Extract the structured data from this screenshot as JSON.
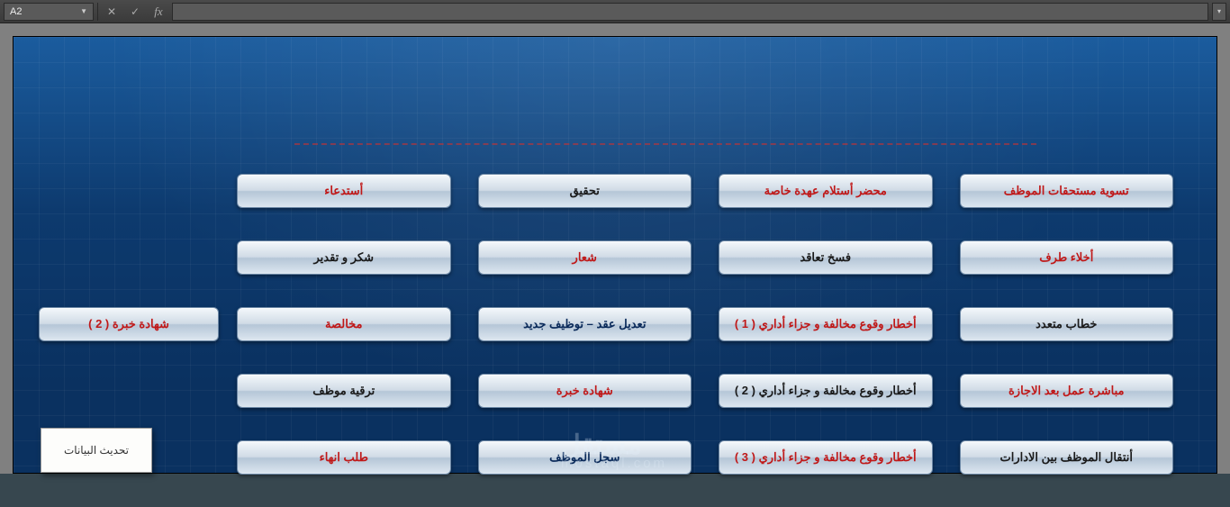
{
  "formula_bar": {
    "cell_ref": "A2",
    "formula": ""
  },
  "buttons": {
    "rows": [
      [
        {
          "label": "تسوية مستحقات الموظف",
          "style": "red"
        },
        {
          "label": "محضر أستلام عهدة خاصة",
          "style": "red"
        },
        {
          "label": "تحقيق",
          "style": "black"
        },
        {
          "label": "أستدعاء",
          "style": "red"
        }
      ],
      [
        {
          "label": "أخلاء طرف",
          "style": "red"
        },
        {
          "label": "فسخ تعاقد",
          "style": "black"
        },
        {
          "label": "شعار",
          "style": "red"
        },
        {
          "label": "شكر و تقدير",
          "style": "black"
        }
      ],
      [
        {
          "label": "خطاب متعدد",
          "style": "black"
        },
        {
          "label": "أخطار وقوع مخالفة و جزاء أداري ( 1 )",
          "style": "red"
        },
        {
          "label": "تعديل عقد – توظيف جديد",
          "style": "navy"
        },
        {
          "label": "مخالصة",
          "style": "red"
        }
      ],
      [
        {
          "label": "مباشرة عمل بعد الاجازة",
          "style": "red"
        },
        {
          "label": "أخطار وقوع مخالفة و جزاء أداري ( 2 )",
          "style": "black"
        },
        {
          "label": "شهادة خبرة",
          "style": "red"
        },
        {
          "label": "ترقية موظف",
          "style": "black"
        }
      ],
      [
        {
          "label": "أنتقال الموظف بين الادارات",
          "style": "black"
        },
        {
          "label": "أخطار وقوع مخالفة و جزاء أداري ( 3 )",
          "style": "red"
        },
        {
          "label": "سجل الموظف",
          "style": "navy"
        },
        {
          "label": "طلب انهاء",
          "style": "red"
        }
      ]
    ],
    "extra": [
      {
        "label": "شهادة خبرة ( 2 )",
        "style": "red"
      }
    ]
  },
  "update_label": "تحديث البيانات",
  "watermark": {
    "big": "مستقل",
    "small": "mostaql.com"
  }
}
